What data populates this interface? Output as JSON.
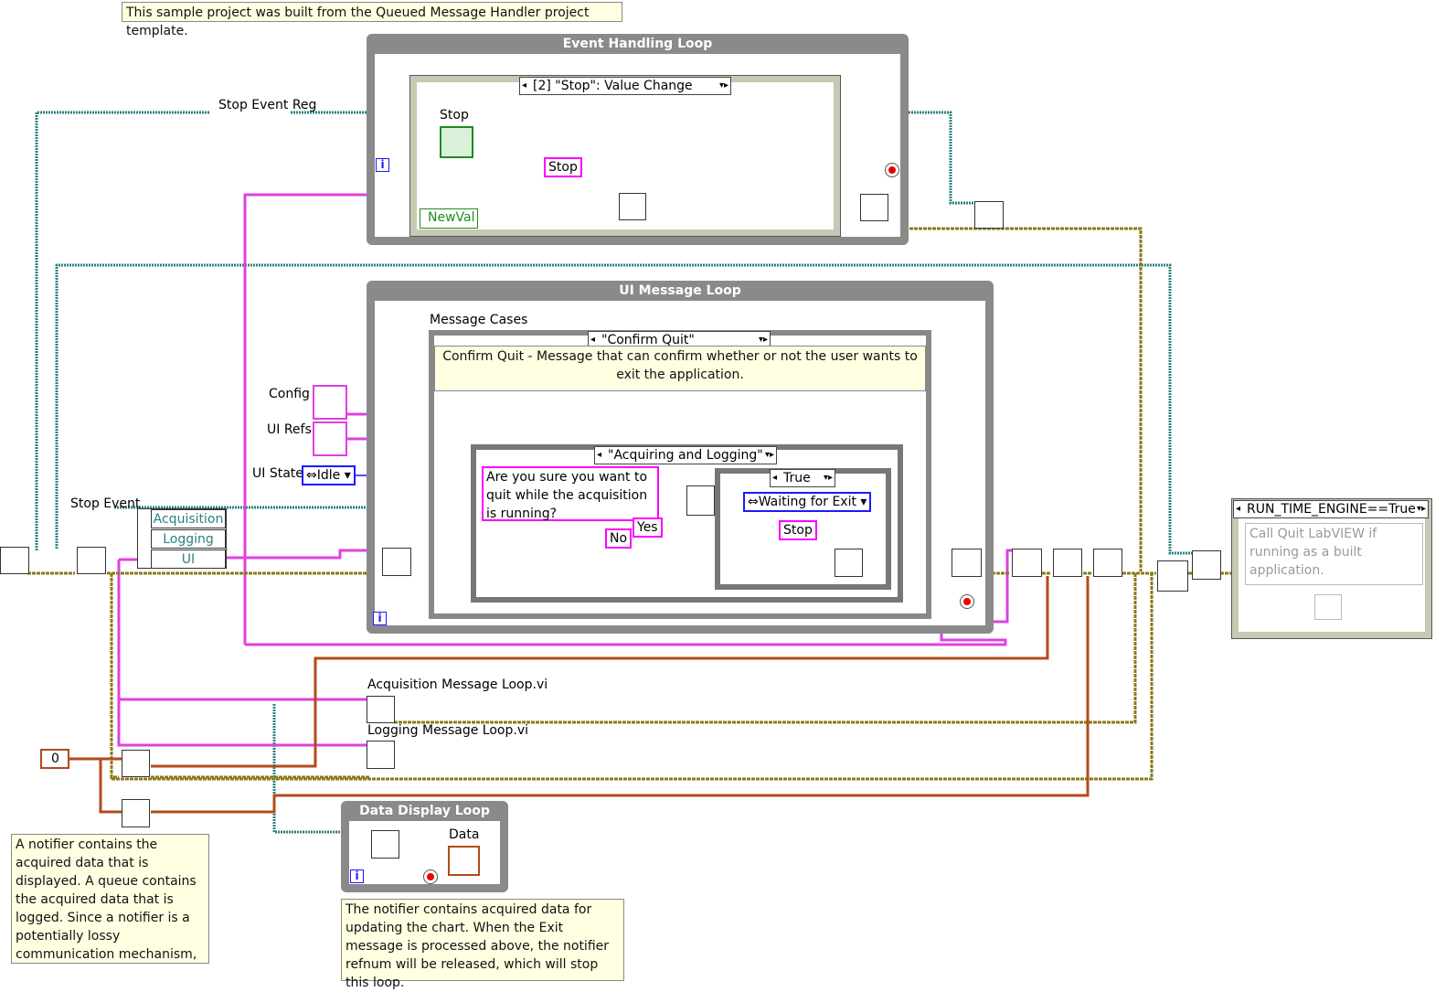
{
  "notes": {
    "template": "This sample project was built from the Queued Message Handler project template.",
    "notifier": "A notifier contains the acquired data that is displayed. A queue contains the acquired data that is logged.  Since a notifier is a potentially lossy communication mechanism, it is ok to use for data display, but",
    "display": "The notifier contains acquired data for updating the chart. When the Exit message is processed above, the notifier refnum will be released, which will stop this loop.",
    "confirm_quit": "Confirm Quit - Message that can confirm whether or not the user wants to exit the application.",
    "runtime": "Call Quit LabVIEW if running as a built application."
  },
  "loops": {
    "event_handling": "Event Handling Loop",
    "ui_message": "UI Message Loop",
    "data_display": "Data Display Loop"
  },
  "selectors": {
    "event_case": "[2] \"Stop\": Value Change",
    "message_case": "\"Confirm Quit\"",
    "acq_case": "\"Acquiring and Logging\"",
    "bool_case": "True",
    "runtime_case": "RUN_TIME_ENGINE==True"
  },
  "labels": {
    "stop_event_reg": "Stop Event Reg",
    "stop_event": "Stop Event",
    "stop": "Stop",
    "newval": "NewVal",
    "message_cases": "Message Cases",
    "config": "Config",
    "ui_refs": "UI Refs",
    "ui_state": "UI State",
    "acq_vi": "Acquisition Message Loop.vi",
    "log_vi": "Logging Message Loop.vi",
    "data": "Data",
    "iteration": "i"
  },
  "constants": {
    "stop_msg_1": "Stop",
    "stop_msg_2": "Stop",
    "ui_state": "Idle",
    "waiting": "Waiting for Exit",
    "prompt": "Are you sure you want to quit while the acquisition is running?",
    "yes": "Yes",
    "no": "No",
    "zero": "0"
  },
  "cluster_items": [
    "Acquisition",
    "Logging",
    "UI"
  ],
  "colors": {
    "loop_gray": "#8a8a8a",
    "string_wire": "#ff00ff",
    "enum_wire": "#1a1aff",
    "refnum_wire": "#2a8080",
    "error_wire": "#8c7a1a",
    "note_bg": "#ffffe1"
  }
}
